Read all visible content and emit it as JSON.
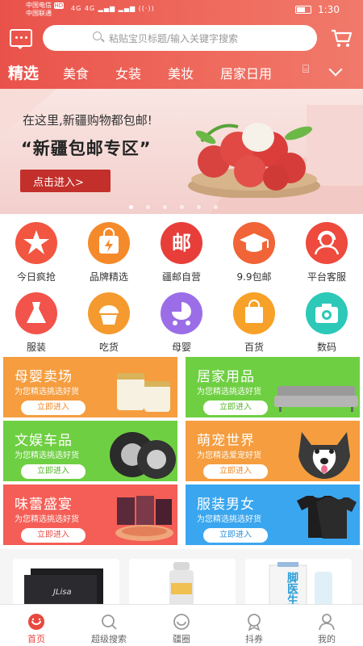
{
  "status_bar": {
    "carrier_line1": "中国电信",
    "carrier_badge": "HD",
    "carrier_line2": "中国联通",
    "signal_text": "4G 4G",
    "time": "1:30"
  },
  "header": {
    "search_placeholder": "粘贴宝贝标题/输入关键字搜索"
  },
  "tabs": [
    "精选",
    "美食",
    "女装",
    "美妆",
    "居家日用",
    "⌸"
  ],
  "banner": {
    "line1": "在这里,新疆购物都包邮!",
    "line2": "“新疆包邮专区”",
    "button": "点击进入>"
  },
  "categories": [
    {
      "label": "今日疯抢",
      "color": "#f25540"
    },
    {
      "label": "品牌精选",
      "color": "#f58a2a"
    },
    {
      "label": "疆邮自营",
      "color": "#e83e3a",
      "glyph": "邮"
    },
    {
      "label": "9.9包邮",
      "color": "#f06437"
    },
    {
      "label": "平台客服",
      "color": "#ee4a3e"
    },
    {
      "label": "服装",
      "color": "#f2534a"
    },
    {
      "label": "吃货",
      "color": "#f59a2f"
    },
    {
      "label": "母婴",
      "color": "#9b6ee8"
    },
    {
      "label": "百货",
      "color": "#f7a128"
    },
    {
      "label": "数码",
      "color": "#2cc8b8"
    }
  ],
  "promos": [
    {
      "title": "母婴卖场",
      "subtitle": "为您精选挑选好货",
      "button": "立即进入",
      "color": "#f59d3f",
      "btn_color": "#f08a2a"
    },
    {
      "title": "居家用品",
      "subtitle": "为您精选挑选好货",
      "button": "立即进入",
      "color": "#6fcf43",
      "btn_color": "#56b52c"
    },
    {
      "title": "文娱车品",
      "subtitle": "为您精选挑选好货",
      "button": "立即进入",
      "color": "#6fcf43",
      "btn_color": "#56b52c"
    },
    {
      "title": "萌宠世界",
      "subtitle": "为您精选爱宠好货",
      "button": "立即进入",
      "color": "#f59d3f",
      "btn_color": "#f08a2a"
    },
    {
      "title": "味蕾盛宴",
      "subtitle": "为您精选挑选好货",
      "button": "立即进入",
      "color": "#f45e56",
      "btn_color": "#ea4d45"
    },
    {
      "title": "服装男女",
      "subtitle": "为您精选挑选好货",
      "button": "立即进入",
      "color": "#3aa6ef",
      "btn_color": "#2e8fd8"
    }
  ],
  "products": [
    "JLisa",
    "",
    "脚医生"
  ],
  "bottom_nav": [
    {
      "label": "首页",
      "active": true
    },
    {
      "label": "超级搜索"
    },
    {
      "label": "疆圈"
    },
    {
      "label": "抖券"
    },
    {
      "label": "我的"
    }
  ]
}
